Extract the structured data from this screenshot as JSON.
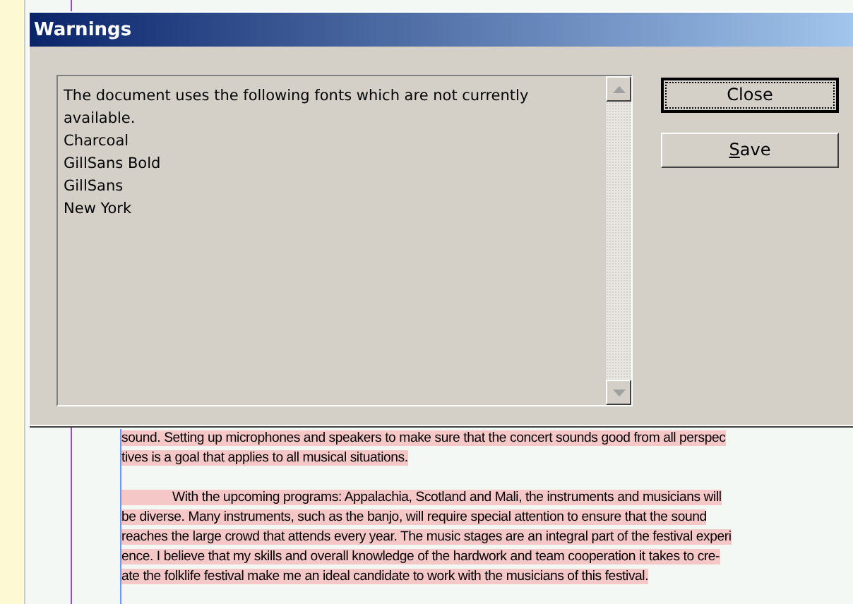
{
  "dialog": {
    "title": "Warnings",
    "message_lines": [
      "The document uses the following fonts which are not currently available.",
      "Charcoal",
      "GillSans Bold",
      "GillSans",
      "New York"
    ],
    "buttons": [
      {
        "label": "Close",
        "focused": true,
        "mnemonic": false
      },
      {
        "label": "Save",
        "focused": false,
        "mnemonic": true
      }
    ]
  },
  "document": {
    "paragraphs": [
      {
        "lines": [
          "sound. Setting up microphones and speakers to make sure that the concert sounds good from all perspec",
          "tives is a goal that applies to all musical situations."
        ]
      },
      {
        "lines": [
          "With the upcoming programs:  Appalachia, Scotland and Mali, the instruments and musicians will",
          "be diverse. Many instruments, such as the banjo, will require special attention to ensure that the sound",
          "reaches the large crowd that attends every year. The music stages are an integral part of the festival experi",
          "ence. I believe that my skills and overall knowledge of the hardwork and team cooperation it takes to cre-",
          "ate the folklife festival make me an ideal candidate to work with the musicians of this festival."
        ]
      }
    ]
  }
}
